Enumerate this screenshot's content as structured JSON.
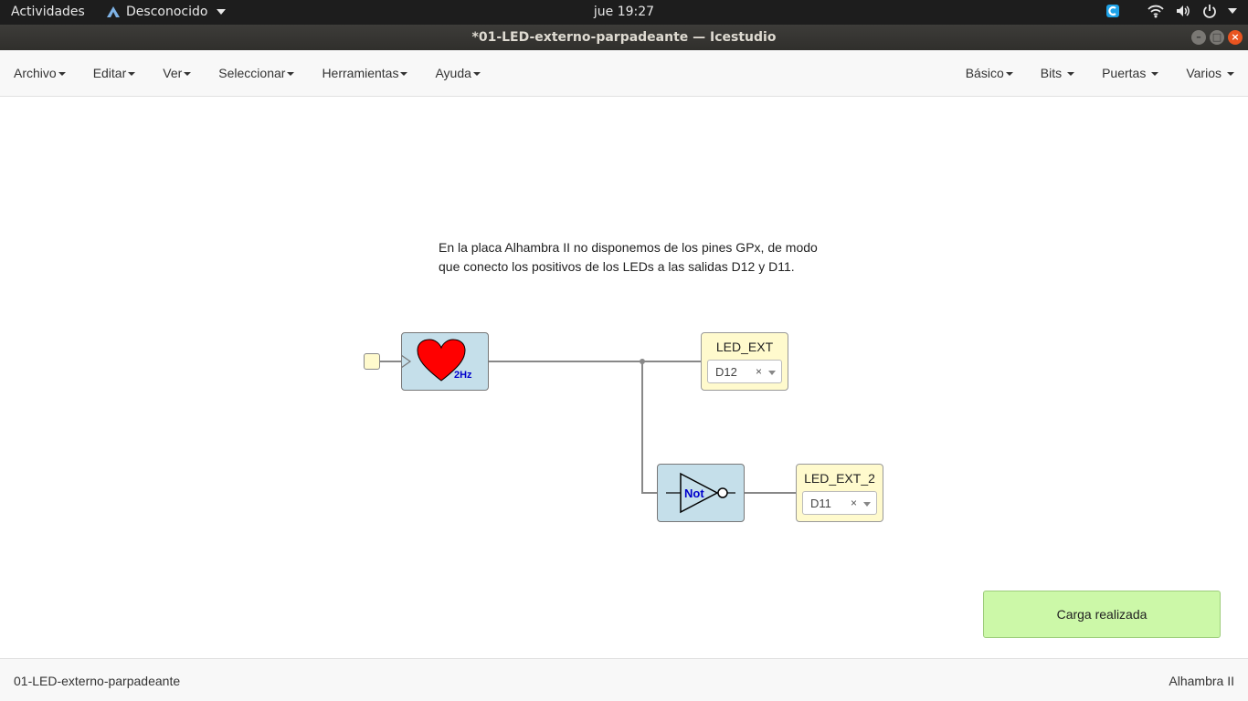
{
  "system": {
    "activities": "Actividades",
    "app_name": "Desconocido",
    "clock": "jue 19:27",
    "tray_icons": [
      "app-indicator-icon",
      "wifi-icon",
      "volume-icon",
      "power-icon"
    ]
  },
  "window": {
    "title": "*01-LED-externo-parpadeante — Icestudio",
    "buttons": [
      "minimize",
      "maximize",
      "close"
    ]
  },
  "menu": {
    "left": [
      "Archivo",
      "Editar",
      "Ver",
      "Seleccionar",
      "Herramientas",
      "Ayuda"
    ],
    "right": [
      "Básico",
      "Bits",
      "Puertas",
      "Varios"
    ]
  },
  "canvas": {
    "note_line1": "En la placa Alhambra II no disponemos de los pines GPx, de modo",
    "note_line2": "que conecto los positivos de los LEDs a las salidas D12 y D11.",
    "heart_block": {
      "label": "2Hz",
      "color": "#ff0000"
    },
    "not_block": {
      "label": "Not"
    },
    "led1": {
      "name": "LED_EXT",
      "pin": "D12",
      "clear": "×"
    },
    "led2": {
      "name": "LED_EXT_2",
      "pin": "D11",
      "clear": "×"
    }
  },
  "toast": {
    "message": "Carga realizada",
    "color": "#ccf8a8"
  },
  "footer": {
    "project": "01-LED-externo-parpadeante",
    "board": "Alhambra II"
  }
}
